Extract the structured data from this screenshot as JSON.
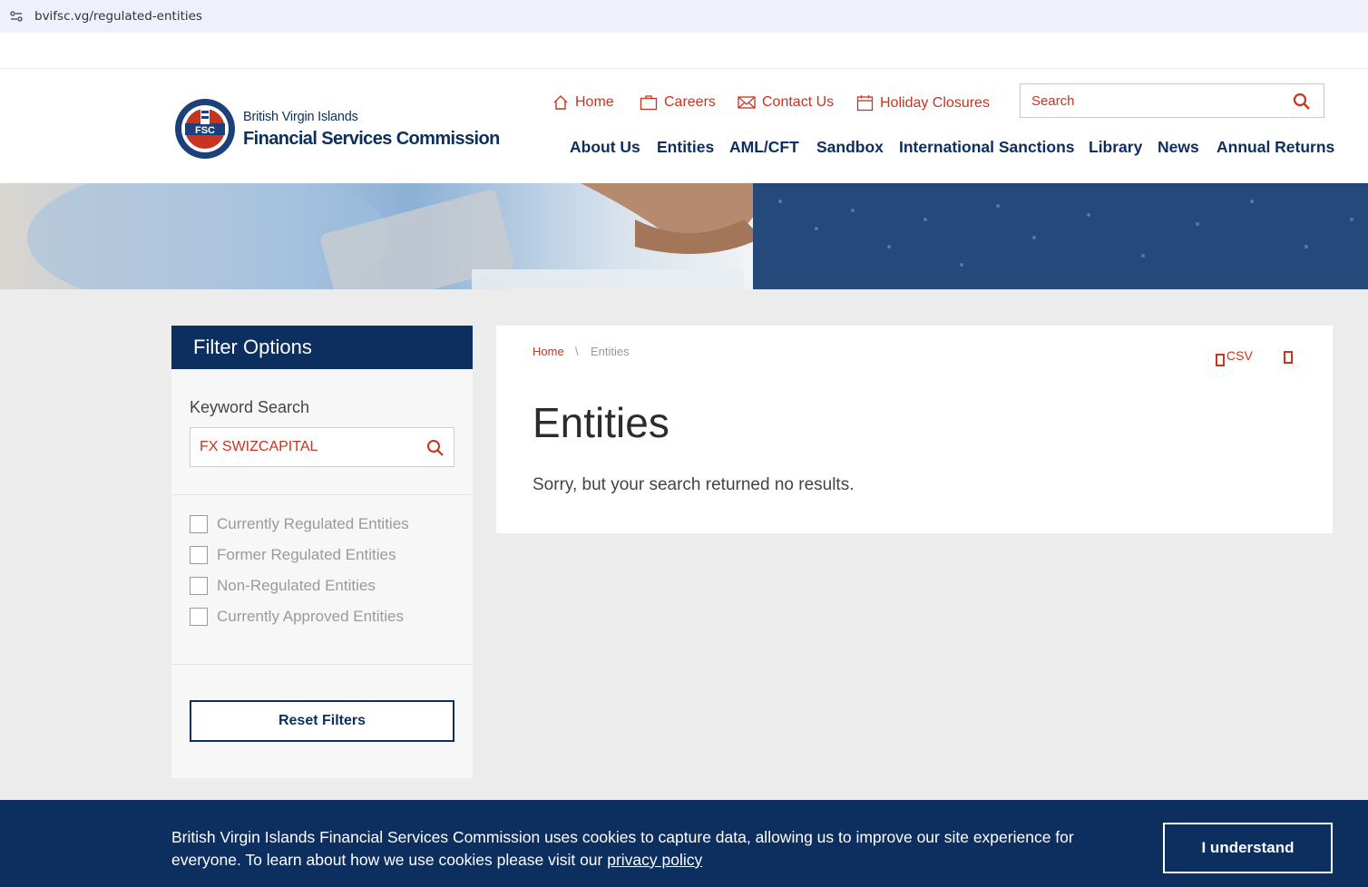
{
  "browser": {
    "url": "bvifsc.vg/regulated-entities"
  },
  "logo": {
    "line1": "British Virgin Islands",
    "line2": "Financial Services Commission"
  },
  "utility_nav": [
    {
      "label": "Home",
      "icon": "home-icon"
    },
    {
      "label": "Careers",
      "icon": "briefcase-icon"
    },
    {
      "label": "Contact Us",
      "icon": "envelope-icon"
    },
    {
      "label": "Holiday Closures",
      "icon": "calendar-icon"
    }
  ],
  "search": {
    "placeholder": "Search"
  },
  "main_nav": [
    "About Us",
    "Entities",
    "AML/CFT",
    "Sandbox",
    "International Sanctions",
    "Library",
    "News",
    "Annual Returns"
  ],
  "filter": {
    "title": "Filter Options",
    "keyword_label": "Keyword Search",
    "keyword_value": "FX SWIZCAPITAL",
    "checkboxes": [
      "Currently Regulated Entities",
      "Former Regulated Entities",
      "Non-Regulated Entities",
      "Currently Approved Entities"
    ],
    "reset_label": "Reset Filters"
  },
  "breadcrumb": {
    "home": "Home",
    "separator": "\\",
    "current": "Entities"
  },
  "export": {
    "csv_label": "CSV"
  },
  "results": {
    "title": "Entities",
    "message": "Sorry, but your search returned no results."
  },
  "cookie": {
    "text": "British Virgin Islands Financial Services Commission uses cookies to capture data, allowing us to improve our site experience for everyone. To learn about how we use cookies please visit our ",
    "link": "privacy policy",
    "button": "I understand"
  },
  "colors": {
    "navy": "#0c2f5f",
    "accent_red": "#c8341e",
    "content_bg": "#ececec"
  }
}
